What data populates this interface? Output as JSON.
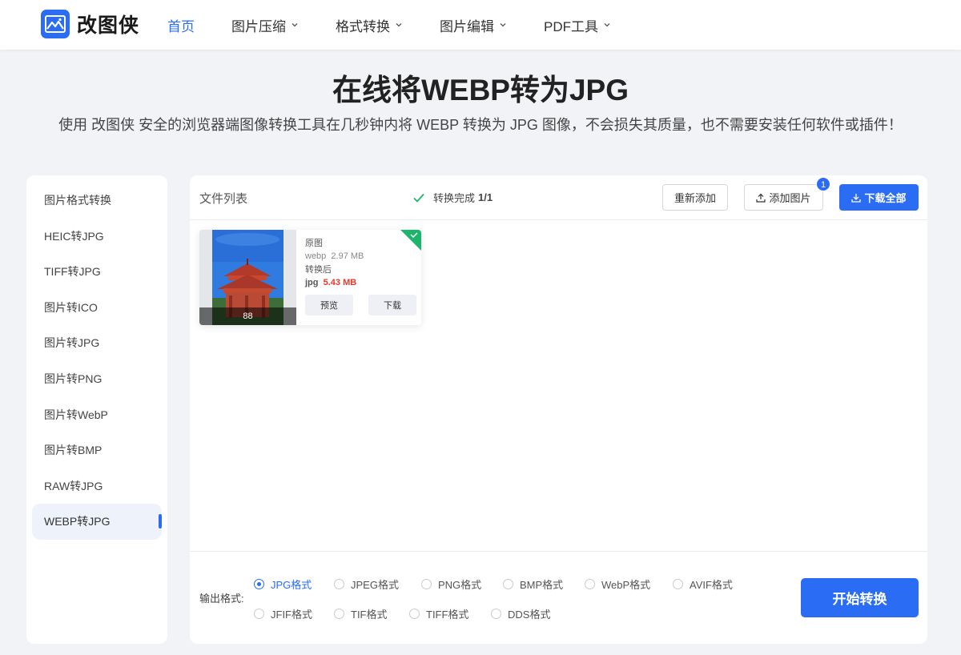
{
  "header": {
    "logo_text": "改图侠",
    "nav": [
      {
        "label": "首页",
        "active": true,
        "dropdown": false
      },
      {
        "label": "图片压缩",
        "active": false,
        "dropdown": true
      },
      {
        "label": "格式转换",
        "active": false,
        "dropdown": true
      },
      {
        "label": "图片编辑",
        "active": false,
        "dropdown": true
      },
      {
        "label": "PDF工具",
        "active": false,
        "dropdown": true
      }
    ]
  },
  "hero": {
    "title": "在线将WEBP转为JPG",
    "subtitle": "使用 改图侠 安全的浏览器端图像转换工具在几秒钟内将 WEBP 转换为 JPG 图像，不会损失其质量，也不需要安装任何软件或插件！"
  },
  "sidebar": {
    "items": [
      {
        "label": "图片格式转换",
        "active": false
      },
      {
        "label": "HEIC转JPG",
        "active": false
      },
      {
        "label": "TIFF转JPG",
        "active": false
      },
      {
        "label": "图片转ICO",
        "active": false
      },
      {
        "label": "图片转JPG",
        "active": false
      },
      {
        "label": "图片转PNG",
        "active": false
      },
      {
        "label": "图片转WebP",
        "active": false
      },
      {
        "label": "图片转BMP",
        "active": false
      },
      {
        "label": "RAW转JPG",
        "active": false
      },
      {
        "label": "WEBP转JPG",
        "active": true
      }
    ]
  },
  "panel": {
    "file_list_label": "文件列表",
    "status_text": "转换完成",
    "status_count": "1/1",
    "readd_label": "重新添加",
    "add_image_label": "添加图片",
    "add_badge": "1",
    "download_all_label": "下载全部"
  },
  "file_card": {
    "thumb_count": "88",
    "original_label": "原图",
    "original_format": "webp",
    "original_size": "2.97 MB",
    "converted_label": "转换后",
    "converted_format": "jpg",
    "converted_size": "5.43 MB",
    "preview_label": "预览",
    "download_label": "下载"
  },
  "output": {
    "label": "输出格式:",
    "formats_row1": [
      "JPG格式",
      "JPEG格式",
      "PNG格式",
      "BMP格式",
      "WebP格式",
      "AVIF格式"
    ],
    "formats_row2": [
      "JFIF格式",
      "TIF格式",
      "TIFF格式",
      "DDS格式"
    ],
    "selected": "JPG格式",
    "start_label": "开始转换"
  },
  "colors": {
    "accent": "#2a6df4",
    "success": "#1fb46b",
    "danger": "#e8372b"
  }
}
